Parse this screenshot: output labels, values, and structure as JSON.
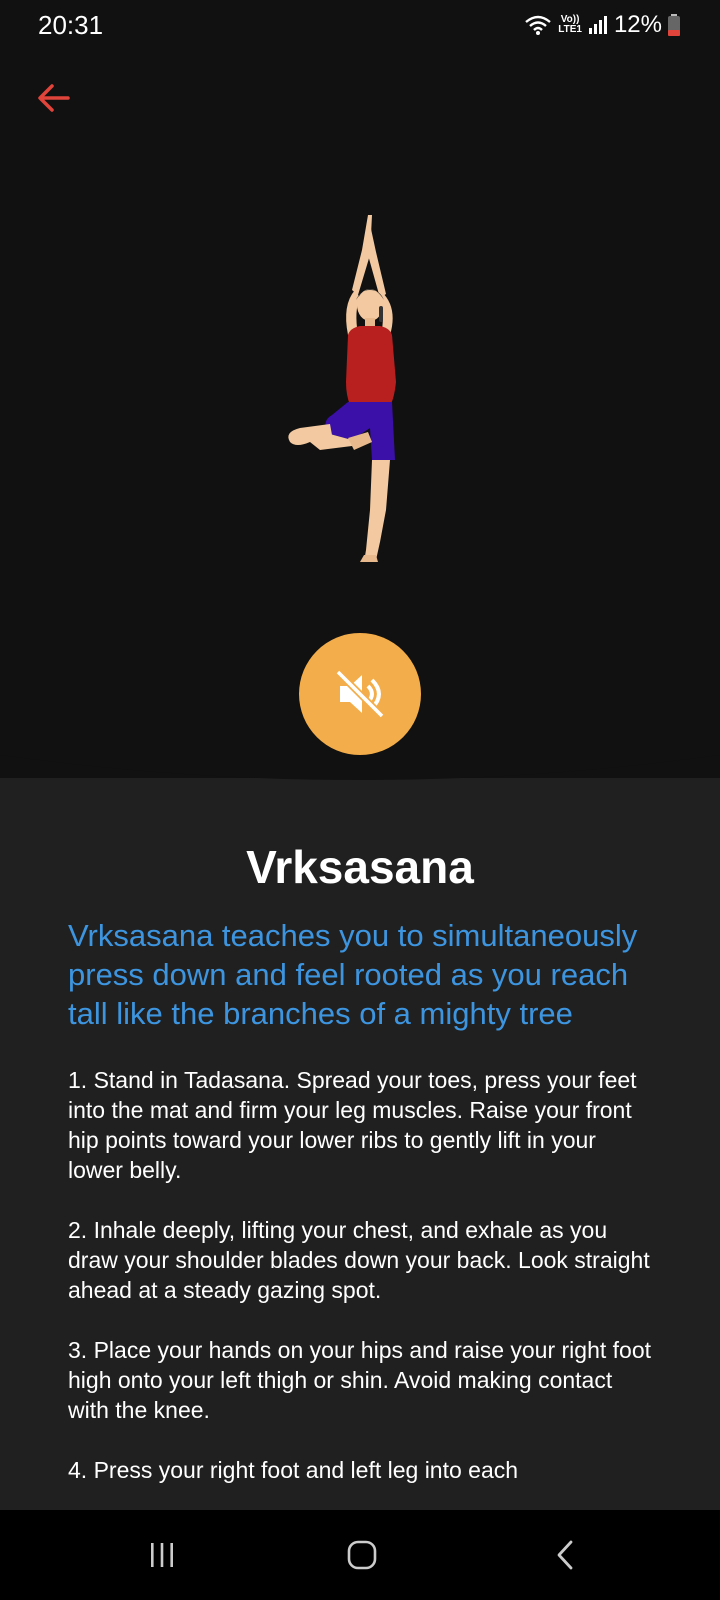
{
  "status_bar": {
    "time": "20:31",
    "battery_percent": "12%",
    "volte_label_top": "Vo))",
    "volte_label_bottom": "LTE1"
  },
  "header": {
    "back_icon": "arrow-left-icon",
    "back_color": "#e0443a"
  },
  "hero": {
    "image_icon": "tree-pose-illustration",
    "mute_icon": "volume-off-icon",
    "mute_button_color": "#f3ad4a"
  },
  "pose": {
    "title": "Vrksasana",
    "subtitle": "Vrksasana teaches you to simultaneously press down and feel rooted as you reach tall like the branches of a mighty tree",
    "steps": [
      "1. Stand in Tadasana. Spread your toes, press your feet into the mat and firm your leg muscles. Raise your front hip points toward your lower ribs to gently lift in your lower belly.",
      "2. Inhale deeply, lifting your chest, and exhale as you draw your shoulder blades down your back. Look straight ahead at a steady gazing spot.",
      "3. Place your hands on your hips and raise your right foot high onto your left thigh or shin. Avoid making contact with the knee.",
      "4. Press your right foot and left leg into each"
    ],
    "subtitle_color": "#3d95e0"
  },
  "nav_bar": {
    "recent_icon": "recent-apps-icon",
    "home_icon": "home-icon",
    "back_icon": "back-chevron-icon"
  }
}
